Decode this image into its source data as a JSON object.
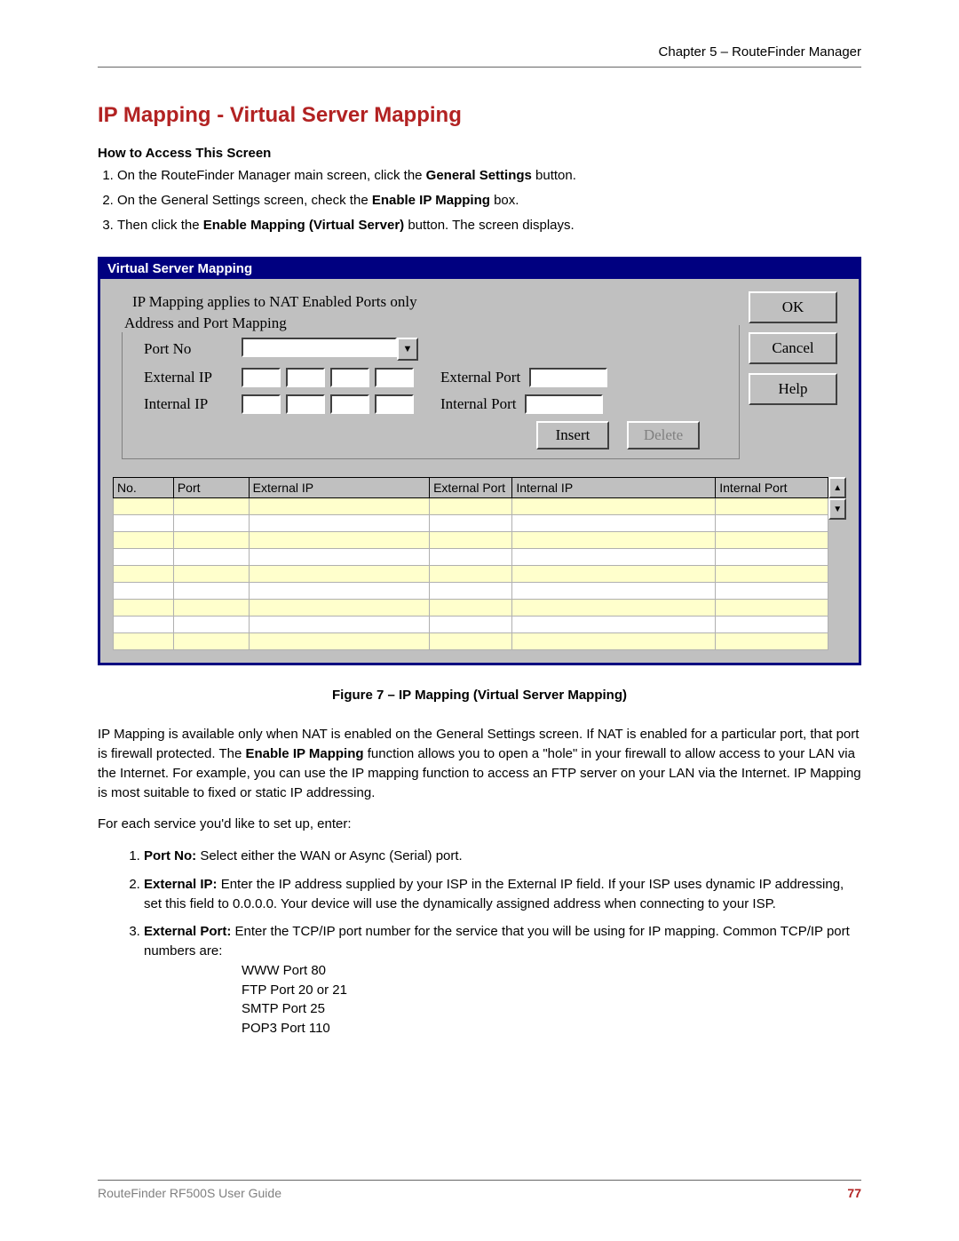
{
  "header": {
    "chapter": "Chapter 5 – RouteFinder Manager"
  },
  "title": "IP Mapping - Virtual Server Mapping",
  "access": {
    "heading": "How to Access This Screen",
    "step1_a": "On the RouteFinder Manager main screen, click the ",
    "step1_b": "General Settings",
    "step1_c": " button.",
    "step2_a": "On the General Settings screen, check the ",
    "step2_b": "Enable IP Mapping",
    "step2_c": " box.",
    "step3_a": "Then click the ",
    "step3_b": "Enable Mapping (Virtual Server)",
    "step3_c": " button. The screen displays."
  },
  "dialog": {
    "title": "Virtual Server Mapping",
    "note": "IP Mapping applies to NAT Enabled Ports only",
    "buttons": {
      "ok": "OK",
      "cancel": "Cancel",
      "help": "Help"
    },
    "group": {
      "legend": "Address and Port Mapping",
      "port_no": "Port No",
      "ext_ip": "External IP",
      "int_ip": "Internal IP",
      "ext_port": "External Port",
      "int_port": "Internal Port",
      "insert": "Insert",
      "delete": "Delete"
    },
    "table": {
      "cols": {
        "no": "No.",
        "port": "Port",
        "ext_ip": "External IP",
        "ext_port": "External Port",
        "int_ip": "Internal IP",
        "int_port": "Internal Port"
      }
    }
  },
  "figcap": "Figure 7 – IP Mapping (Virtual Server Mapping)",
  "body": {
    "p1_a": "IP Mapping is available only when NAT is enabled on the General Settings screen. If NAT is enabled for a particular port, that port is firewall protected. The ",
    "p1_b": "Enable IP Mapping",
    "p1_c": " function allows you to open a \"hole\" in your firewall to allow access to your LAN via the Internet. For example, you can use the IP mapping function to access an FTP server on your LAN via the Internet. IP Mapping is most suitable to fixed or static IP addressing.",
    "p2": "For each service you'd like to set up, enter:",
    "s1_b": "Port No:",
    "s1_t": " Select either the WAN or Async (Serial) port.",
    "s2_b": "External IP:",
    "s2_t": " Enter the IP address supplied by your ISP in the External IP field. If your ISP uses dynamic IP addressing, set this field to 0.0.0.0. Your device will use the dynamically assigned address when connecting to your ISP.",
    "s3_b": "External Port:",
    "s3_t": " Enter the TCP/IP port number for the service that you will be using for IP mapping. Common TCP/IP port numbers are:",
    "ports": {
      "a": "WWW Port 80",
      "b": "FTP Port 20 or 21",
      "c": "SMTP Port 25",
      "d": "POP3 Port 110"
    }
  },
  "footer": {
    "guide": "RouteFinder RF500S User Guide",
    "page": "77"
  }
}
